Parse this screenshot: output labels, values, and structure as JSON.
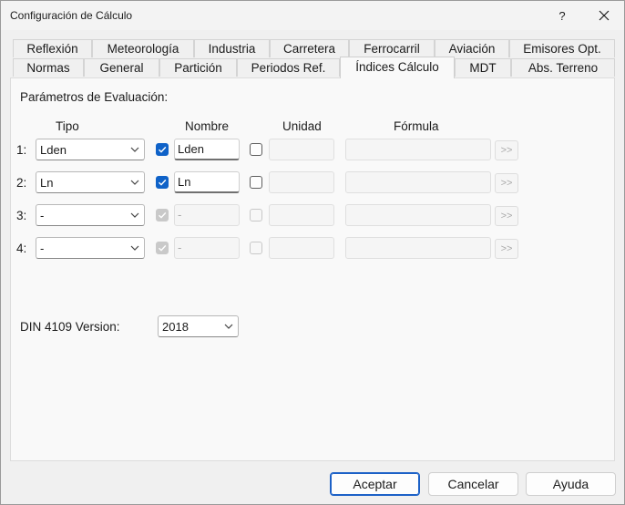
{
  "window": {
    "title": "Configuración de Cálculo",
    "help": "?"
  },
  "tabs_top": [
    "Reflexión",
    "Meteorología",
    "Industria",
    "Carretera",
    "Ferrocarril",
    "Aviación",
    "Emisores Opt."
  ],
  "tabs_bottom": [
    "Normas",
    "General",
    "Partición",
    "Periodos Ref.",
    "Índices Cálculo",
    "MDT",
    "Abs. Terreno"
  ],
  "active_tab": "Índices Cálculo",
  "section": {
    "title": "Parámetros de Evaluación:"
  },
  "columns": {
    "tipo": "Tipo",
    "nombre": "Nombre",
    "unidad": "Unidad",
    "formula": "Fórmula"
  },
  "rows": [
    {
      "index": "1:",
      "tipo": "Lden",
      "nombre_checked": true,
      "nombre": "Lden",
      "enabled": true,
      "unidad_checked": false,
      "unidad": "",
      "formula": "",
      "formula_button": ">>"
    },
    {
      "index": "2:",
      "tipo": "Ln",
      "nombre_checked": true,
      "nombre": "Ln",
      "enabled": true,
      "unidad_checked": false,
      "unidad": "",
      "formula": "",
      "formula_button": ">>"
    },
    {
      "index": "3:",
      "tipo": "-",
      "nombre_checked": true,
      "nombre": "-",
      "enabled": false,
      "unidad_checked": false,
      "unidad": "",
      "formula": "",
      "formula_button": ">>"
    },
    {
      "index": "4:",
      "tipo": "-",
      "nombre_checked": true,
      "nombre": "-",
      "enabled": false,
      "unidad_checked": false,
      "unidad": "",
      "formula": "",
      "formula_button": ">>"
    }
  ],
  "din": {
    "label": "DIN 4109 Version:",
    "value": "2018"
  },
  "buttons": {
    "accept": "Aceptar",
    "cancel": "Cancelar",
    "help": "Ayuda"
  },
  "colors": {
    "accent": "#0f62c8",
    "panel": "#f9f9f9",
    "background": "#f0f0f0"
  },
  "icons": {
    "close": "close-icon",
    "chevron": "chevron-down-icon",
    "check": "check-icon"
  }
}
